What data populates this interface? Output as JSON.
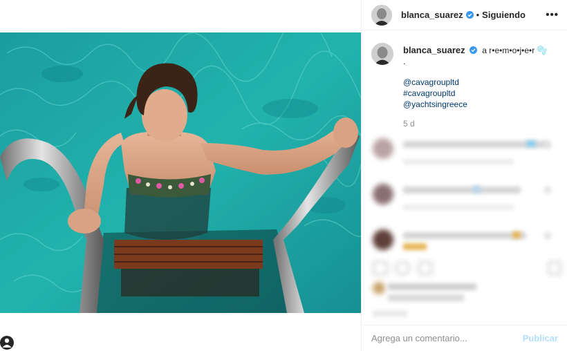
{
  "header": {
    "username": "blanca_suarez",
    "separator": "•",
    "follow_status": "Siguiendo",
    "more_label": "•••"
  },
  "caption": {
    "username": "blanca_suarez",
    "text": "a r•e•m•o•j•e•r 🫧",
    "dot": ".",
    "tags": [
      "@cavagroupltd",
      "#cavagroupltd",
      "@yachtsingreece"
    ],
    "time": "5 d"
  },
  "footer": {
    "placeholder": "Agrega un comentario...",
    "publish_label": "Publicar"
  },
  "icons": {
    "verified": "verified-badge-icon",
    "more": "more-options-icon",
    "profile": "profile-icon"
  },
  "colors": {
    "link": "#00376b",
    "publish_disabled": "#b2dffc",
    "verified": "#3897f0",
    "water": "#1aa7a5"
  }
}
